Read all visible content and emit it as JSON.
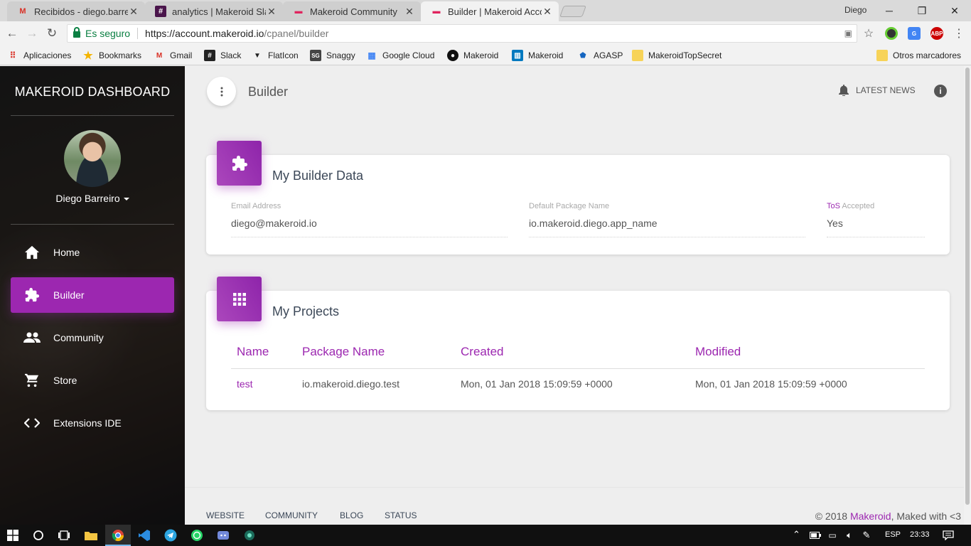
{
  "browser": {
    "tabs": [
      {
        "title": "Recibidos - diego.barreiro",
        "favicon": "gmail-icon",
        "active": false
      },
      {
        "title": "analytics | Makeroid Slack",
        "favicon": "slack-icon",
        "active": false
      },
      {
        "title": "Makeroid Community",
        "favicon": "makeroid-icon",
        "active": false
      },
      {
        "title": "Builder | Makeroid Account",
        "favicon": "makeroid-icon",
        "active": true
      }
    ],
    "profile_name": "Diego",
    "secure_label": "Es seguro",
    "url_scheme_host": "https://account.makeroid.io",
    "url_path": "/cpanel/builder",
    "bookmarks": [
      "Aplicaciones",
      "Bookmarks",
      "Gmail",
      "Slack",
      "FlatIcon",
      "Snaggy",
      "Google Cloud",
      "Makeroid",
      "Makeroid",
      "AGASP",
      "MakeroidTopSecret"
    ],
    "other_bookmarks": "Otros marcadores",
    "extension_abp": "ABP"
  },
  "sidebar": {
    "brand": "MAKEROID DASHBOARD",
    "user_name": "Diego Barreiro",
    "items": [
      {
        "label": "Home",
        "icon": "home-icon",
        "active": false
      },
      {
        "label": "Builder",
        "icon": "puzzle-icon",
        "active": true
      },
      {
        "label": "Community",
        "icon": "people-icon",
        "active": false
      },
      {
        "label": "Store",
        "icon": "cart-icon",
        "active": false
      },
      {
        "label": "Extensions IDE",
        "icon": "code-icon",
        "active": false
      }
    ]
  },
  "header": {
    "page_title": "Builder",
    "latest_news": "LATEST NEWS"
  },
  "builder_card": {
    "title": "My Builder Data",
    "fields": {
      "email_label": "Email Address",
      "email_value": "diego@makeroid.io",
      "package_label": "Default Package Name",
      "package_value": "io.makeroid.diego.app_name",
      "tos_link": "ToS",
      "tos_label_rest": " Accepted",
      "tos_value": "Yes"
    }
  },
  "projects_card": {
    "title": "My Projects",
    "columns": [
      "Name",
      "Package Name",
      "Created",
      "Modified"
    ],
    "rows": [
      {
        "name": "test",
        "package": "io.makeroid.diego.test",
        "created": "Mon, 01 Jan 2018 15:09:59 +0000",
        "modified": "Mon, 01 Jan 2018 15:09:59 +0000"
      }
    ]
  },
  "footer": {
    "links": [
      "WEBSITE",
      "COMMUNITY",
      "BLOG",
      "STATUS"
    ],
    "copyright_prefix": "© 2018 ",
    "copyright_brand": "Makeroid",
    "copyright_suffix": ", Maked with <3"
  },
  "taskbar": {
    "language": "ESP",
    "time": "23:33"
  },
  "colors": {
    "accent": "#9c27b0",
    "secure_green": "#0b8043"
  }
}
